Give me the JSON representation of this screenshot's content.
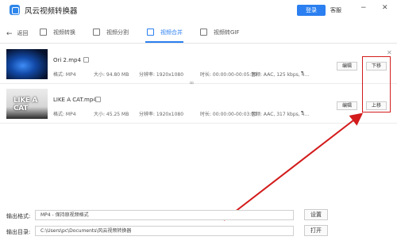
{
  "app": {
    "title": "风云视频转换器",
    "login_label": "登录",
    "guest_label": "客服",
    "window_controls": [
      "minimize-icon",
      "close-icon"
    ]
  },
  "nav": {
    "back_label": "返回",
    "tabs": [
      {
        "label": "视频转换",
        "icon": "video-icon",
        "active": false
      },
      {
        "label": "视频分割",
        "icon": "crop-icon",
        "active": false
      },
      {
        "label": "视频合并",
        "icon": "merge-icon",
        "active": true
      },
      {
        "label": "视频转GIF",
        "icon": "image-icon",
        "active": false
      }
    ]
  },
  "files": [
    {
      "name": "Ori 2.mp4",
      "format": "格式: MP4",
      "size": "大小: 94.80 MB",
      "resolution": "分辨率: 1920x1080",
      "duration": "时长: 00:00:00-00:05:39",
      "audio": "音频: AAC, 125 kbps, 4...",
      "edit_label": "编辑",
      "move_label": "下移"
    },
    {
      "name": "LIKE A CAT.mp4",
      "thumb_text": "LIKE A CAT",
      "format": "格式: MP4",
      "size": "大小: 45.25 MB",
      "resolution": "分辨率: 1920x1080",
      "duration": "时长: 00:00:00-00:03:01",
      "audio": "音频: AAC, 317 kbps, 4...",
      "edit_label": "编辑",
      "move_label": "上移"
    }
  ],
  "output": {
    "format_label": "输出格式:",
    "format_value": "MP4 - 保持原视频格式",
    "settings_label": "设置",
    "dir_label": "输出目录:",
    "dir_value": "C:\\Users\\pc\\Documents\\风云视频转换器",
    "open_label": "打开"
  },
  "colors": {
    "accent": "#2b7ff0",
    "annotation": "#d31b1b"
  }
}
